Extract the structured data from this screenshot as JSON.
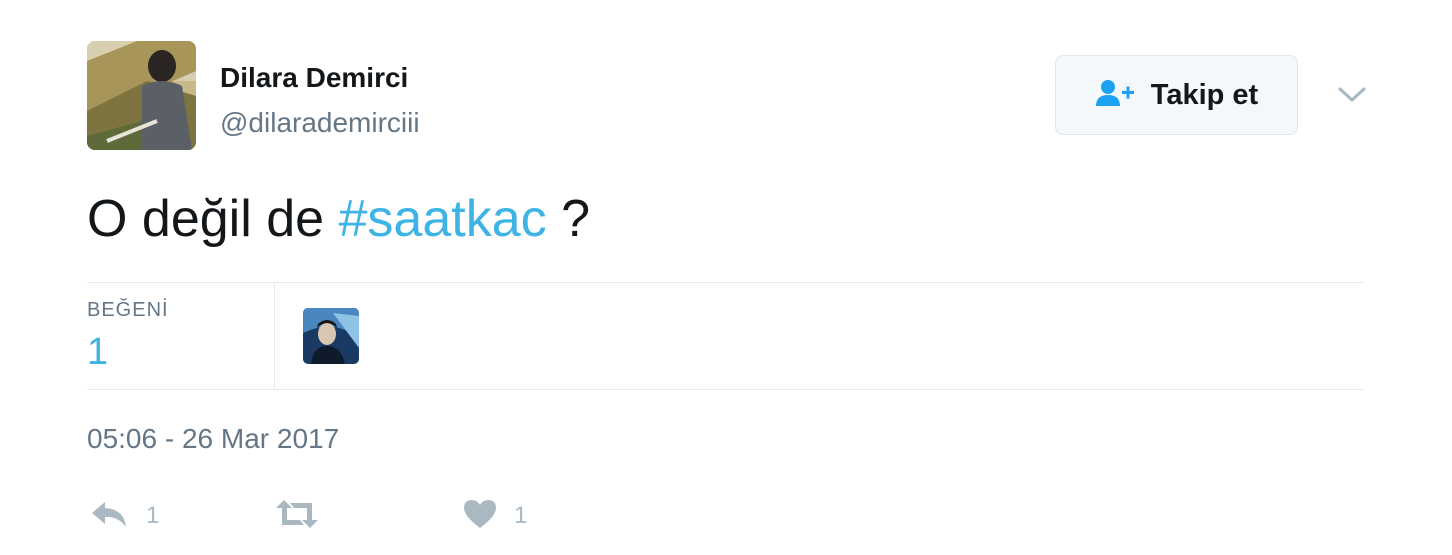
{
  "user": {
    "name": "Dilara Demirci",
    "handle": "@dilarademirciii"
  },
  "follow": {
    "label": "Takip et",
    "icon": "add-user-icon"
  },
  "tweet": {
    "text_before": "O değil de ",
    "hashtag": "#saatkac",
    "text_after": " ?"
  },
  "stats": {
    "likes_label": "BEĞENİ",
    "likes_count": "1"
  },
  "timestamp": "05:06 - 26 Mar 2017",
  "actions": {
    "reply": {
      "icon": "reply-icon",
      "count": "1"
    },
    "retweet": {
      "icon": "retweet-icon",
      "count": ""
    },
    "like": {
      "icon": "heart-icon",
      "count": "1"
    }
  },
  "colors": {
    "accent": "#3db4e5",
    "text": "#14171a",
    "muted": "#657786",
    "icon_muted": "#aab8c2"
  }
}
